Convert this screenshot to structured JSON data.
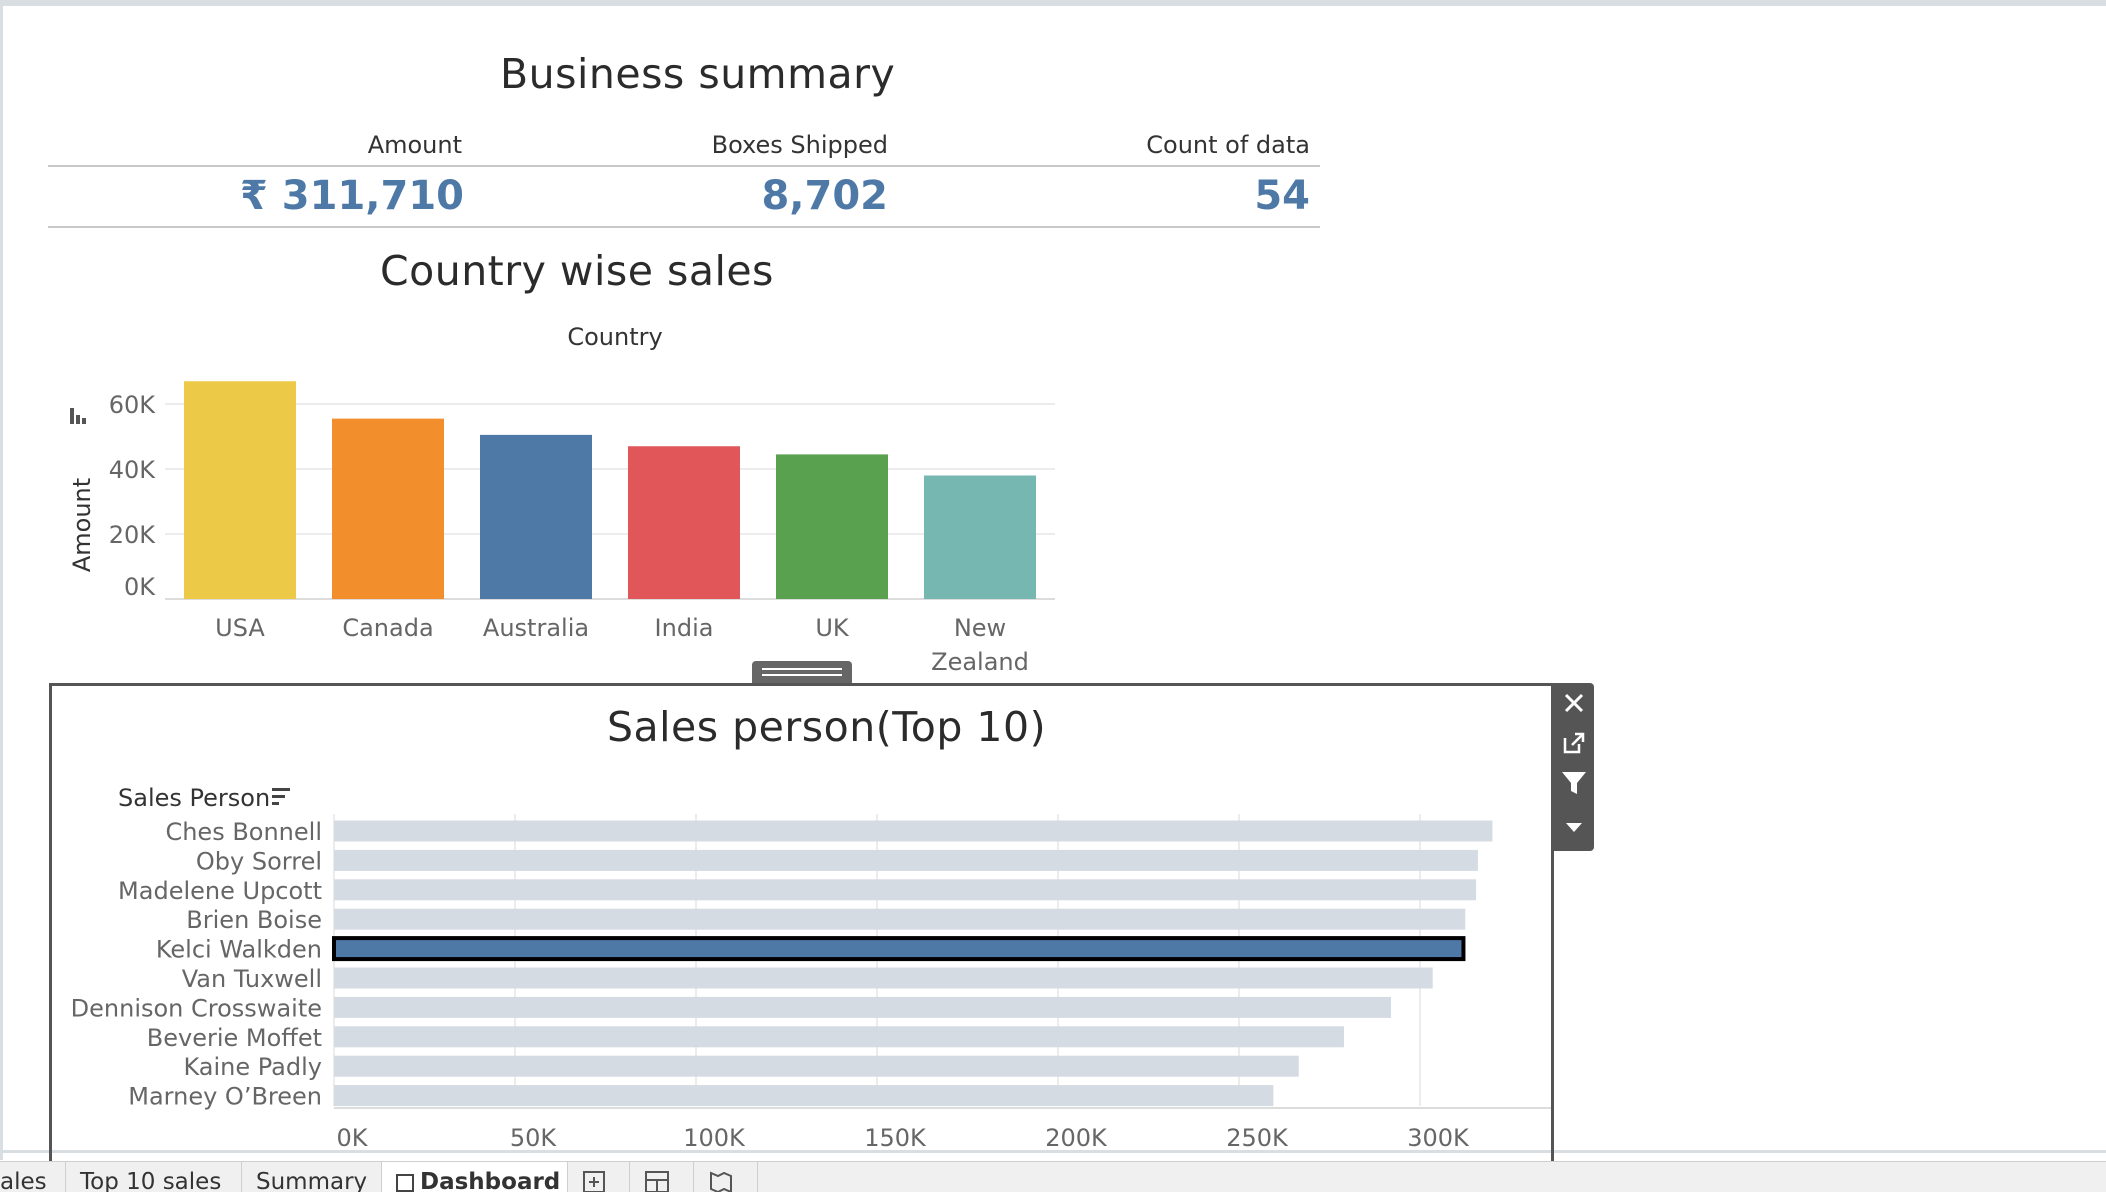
{
  "summary": {
    "title": "Business summary",
    "kpis": [
      {
        "label": "Amount",
        "value": "₹ 311,710"
      },
      {
        "label": "Boxes Shipped",
        "value": "8,702"
      },
      {
        "label": "Count of data",
        "value": "54"
      }
    ]
  },
  "country_chart": {
    "title": "Country wise sales",
    "header": "Country",
    "ylabel": "Amount",
    "ticks": [
      "0K",
      "20K",
      "40K",
      "60K"
    ]
  },
  "sales_chart": {
    "title": "Sales person(Top 10)",
    "header": "Sales Person",
    "ticks": [
      "0K",
      "50K",
      "100K",
      "150K",
      "200K",
      "250K",
      "300K"
    ]
  },
  "chart_data": [
    {
      "type": "bar",
      "title": "Country wise sales",
      "xlabel": "Country",
      "ylabel": "Amount",
      "categories": [
        "USA",
        "Canada",
        "Australia",
        "India",
        "UK",
        "New Zealand"
      ],
      "values": [
        67000,
        55500,
        50500,
        47000,
        44500,
        38000
      ],
      "colors": [
        "#edc948",
        "#f28e2b",
        "#4e79a7",
        "#e15759",
        "#59a14f",
        "#76b7b2"
      ],
      "ylim": [
        0,
        68000
      ],
      "yticks": [
        0,
        20000,
        40000,
        60000
      ],
      "grid": true
    },
    {
      "type": "bar",
      "orientation": "horizontal",
      "title": "Sales person(Top 10)",
      "ylabel": "Sales Person",
      "categories": [
        "Ches Bonnell",
        "Oby Sorrel",
        "Madelene Upcott",
        "Brien Boise",
        "Kelci Walkden",
        "Van Tuxwell",
        "Dennison Crosswaite",
        "Beverie Moffet",
        "Kaine Padly",
        "Marney O’Breen"
      ],
      "values": [
        320000,
        316000,
        315500,
        312500,
        312000,
        303500,
        292000,
        279000,
        266500,
        259500
      ],
      "highlighted": "Kelci Walkden",
      "bar_color": "#d5dbe3",
      "highlight_color": "#4e79a7",
      "xlim": [
        0,
        330000
      ],
      "xticks": [
        0,
        50000,
        100000,
        150000,
        200000,
        250000,
        300000
      ],
      "grid": true
    }
  ],
  "tabs": [
    {
      "label": "ales",
      "active": false
    },
    {
      "label": "Top 10 sales",
      "active": false
    },
    {
      "label": "Summary",
      "active": false
    },
    {
      "label": "Dashboard",
      "active": true
    }
  ],
  "icons": {
    "toolbar": [
      "close-icon",
      "open-new-icon",
      "filter-icon",
      "more-options-icon"
    ],
    "tabs": [
      "new-worksheet-icon",
      "new-dashboard-icon",
      "new-story-icon"
    ]
  }
}
